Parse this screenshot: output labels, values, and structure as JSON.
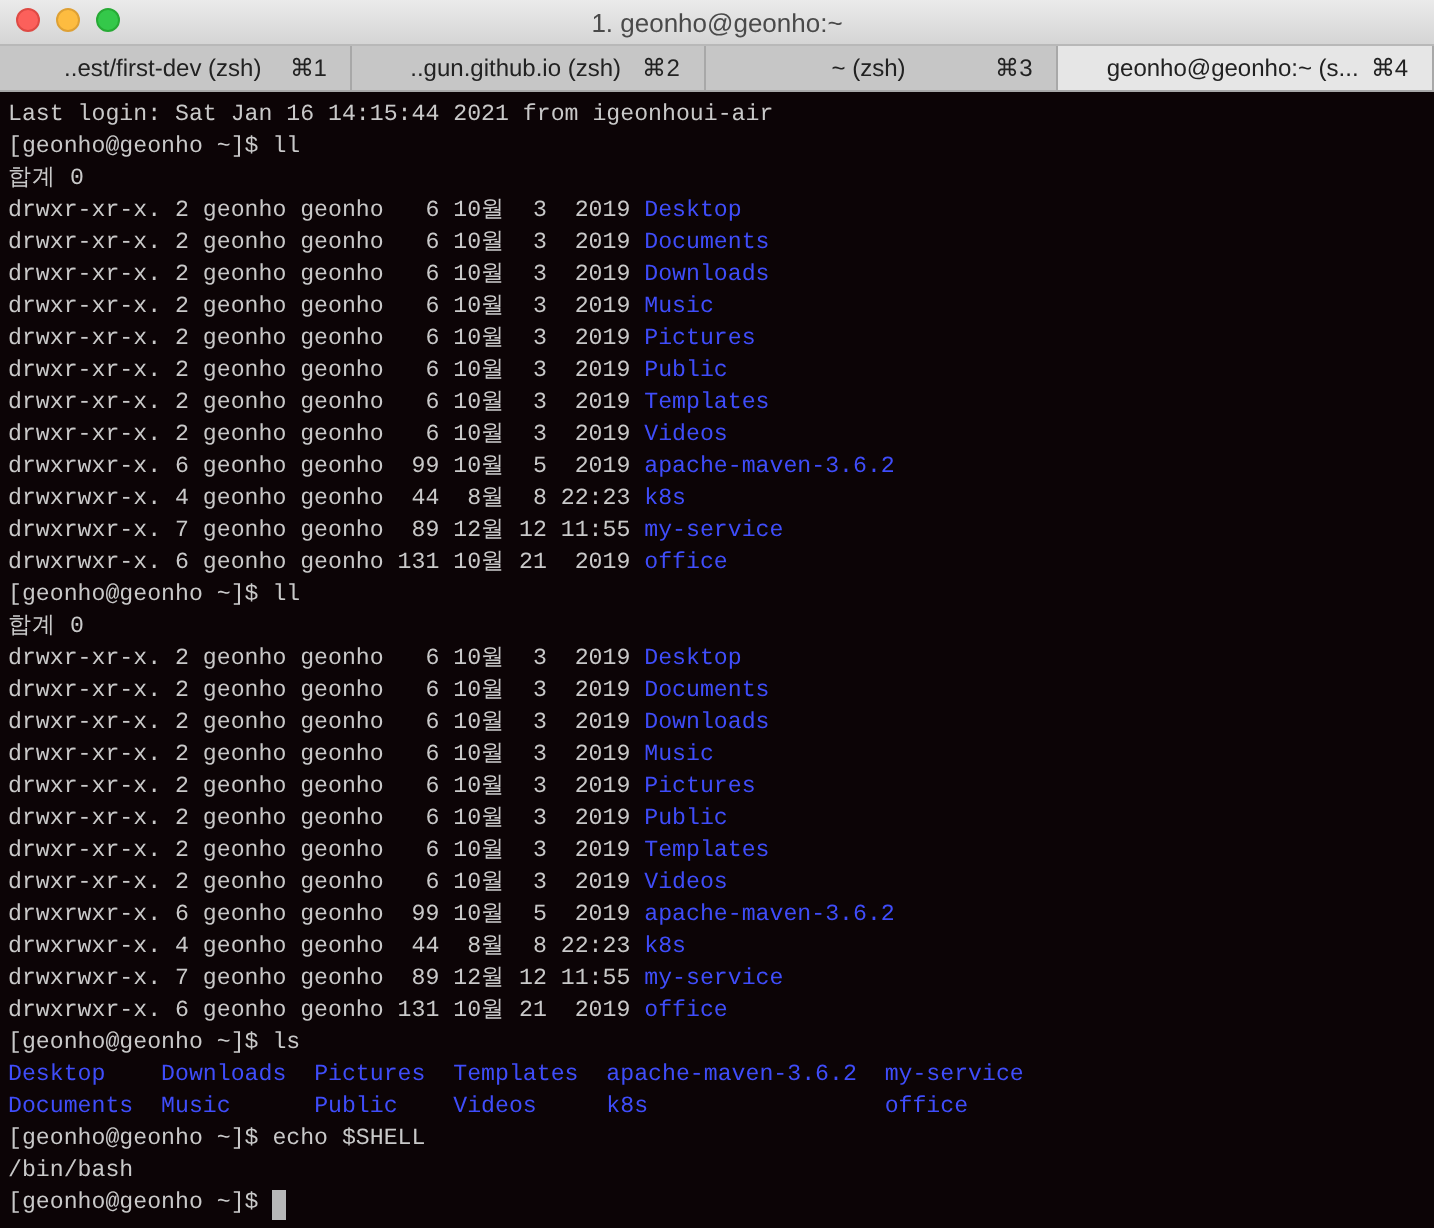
{
  "window": {
    "title": "1. geonho@geonho:~"
  },
  "tabs": [
    {
      "label": "..est/first-dev (zsh)",
      "shortcut": "⌘1",
      "selected": false
    },
    {
      "label": "..gun.github.io (zsh)",
      "shortcut": "⌘2",
      "selected": false
    },
    {
      "label": "~ (zsh)",
      "shortcut": "⌘3",
      "selected": false
    },
    {
      "label": "geonho@geonho:~ (s...",
      "shortcut": "⌘4",
      "selected": true
    }
  ],
  "lines": [
    {
      "kind": "text",
      "text": "Last login: Sat Jan 16 14:15:44 2021 from igeonhoui-air"
    },
    {
      "kind": "text",
      "text": "[geonho@geonho ~]$ ll"
    },
    {
      "kind": "text",
      "text": "합계 0"
    },
    {
      "kind": "entry",
      "info": "drwxr-xr-x. 2 geonho geonho   6 10월  3  2019",
      "name": "Desktop"
    },
    {
      "kind": "entry",
      "info": "drwxr-xr-x. 2 geonho geonho   6 10월  3  2019",
      "name": "Documents"
    },
    {
      "kind": "entry",
      "info": "drwxr-xr-x. 2 geonho geonho   6 10월  3  2019",
      "name": "Downloads"
    },
    {
      "kind": "entry",
      "info": "drwxr-xr-x. 2 geonho geonho   6 10월  3  2019",
      "name": "Music"
    },
    {
      "kind": "entry",
      "info": "drwxr-xr-x. 2 geonho geonho   6 10월  3  2019",
      "name": "Pictures"
    },
    {
      "kind": "entry",
      "info": "drwxr-xr-x. 2 geonho geonho   6 10월  3  2019",
      "name": "Public"
    },
    {
      "kind": "entry",
      "info": "drwxr-xr-x. 2 geonho geonho   6 10월  3  2019",
      "name": "Templates"
    },
    {
      "kind": "entry",
      "info": "drwxr-xr-x. 2 geonho geonho   6 10월  3  2019",
      "name": "Videos"
    },
    {
      "kind": "entry",
      "info": "drwxrwxr-x. 6 geonho geonho  99 10월  5  2019",
      "name": "apache-maven-3.6.2"
    },
    {
      "kind": "entry",
      "info": "drwxrwxr-x. 4 geonho geonho  44  8월  8 22:23",
      "name": "k8s"
    },
    {
      "kind": "entry",
      "info": "drwxrwxr-x. 7 geonho geonho  89 12월 12 11:55",
      "name": "my-service"
    },
    {
      "kind": "entry",
      "info": "drwxrwxr-x. 6 geonho geonho 131 10월 21  2019",
      "name": "office"
    },
    {
      "kind": "text",
      "text": "[geonho@geonho ~]$ ll"
    },
    {
      "kind": "text",
      "text": "합계 0"
    },
    {
      "kind": "entry",
      "info": "drwxr-xr-x. 2 geonho geonho   6 10월  3  2019",
      "name": "Desktop"
    },
    {
      "kind": "entry",
      "info": "drwxr-xr-x. 2 geonho geonho   6 10월  3  2019",
      "name": "Documents"
    },
    {
      "kind": "entry",
      "info": "drwxr-xr-x. 2 geonho geonho   6 10월  3  2019",
      "name": "Downloads"
    },
    {
      "kind": "entry",
      "info": "drwxr-xr-x. 2 geonho geonho   6 10월  3  2019",
      "name": "Music"
    },
    {
      "kind": "entry",
      "info": "drwxr-xr-x. 2 geonho geonho   6 10월  3  2019",
      "name": "Pictures"
    },
    {
      "kind": "entry",
      "info": "drwxr-xr-x. 2 geonho geonho   6 10월  3  2019",
      "name": "Public"
    },
    {
      "kind": "entry",
      "info": "drwxr-xr-x. 2 geonho geonho   6 10월  3  2019",
      "name": "Templates"
    },
    {
      "kind": "entry",
      "info": "drwxr-xr-x. 2 geonho geonho   6 10월  3  2019",
      "name": "Videos"
    },
    {
      "kind": "entry",
      "info": "drwxrwxr-x. 6 geonho geonho  99 10월  5  2019",
      "name": "apache-maven-3.6.2"
    },
    {
      "kind": "entry",
      "info": "drwxrwxr-x. 4 geonho geonho  44  8월  8 22:23",
      "name": "k8s"
    },
    {
      "kind": "entry",
      "info": "drwxrwxr-x. 7 geonho geonho  89 12월 12 11:55",
      "name": "my-service"
    },
    {
      "kind": "entry",
      "info": "drwxrwxr-x. 6 geonho geonho 131 10월 21  2019",
      "name": "office"
    },
    {
      "kind": "text",
      "text": "[geonho@geonho ~]$ ls"
    },
    {
      "kind": "columns",
      "columns": [
        [
          "Desktop",
          "Documents"
        ],
        [
          "Downloads",
          "Music"
        ],
        [
          "Pictures",
          "Public"
        ],
        [
          "Templates",
          "Videos"
        ],
        [
          "apache-maven-3.6.2",
          "k8s"
        ],
        [
          "my-service",
          "office"
        ]
      ]
    },
    {
      "kind": "text",
      "text": "[geonho@geonho ~]$ echo $SHELL"
    },
    {
      "kind": "text",
      "text": "/bin/bash"
    },
    {
      "kind": "text",
      "text": "[geonho@geonho ~]$",
      "cursor": true
    }
  ]
}
